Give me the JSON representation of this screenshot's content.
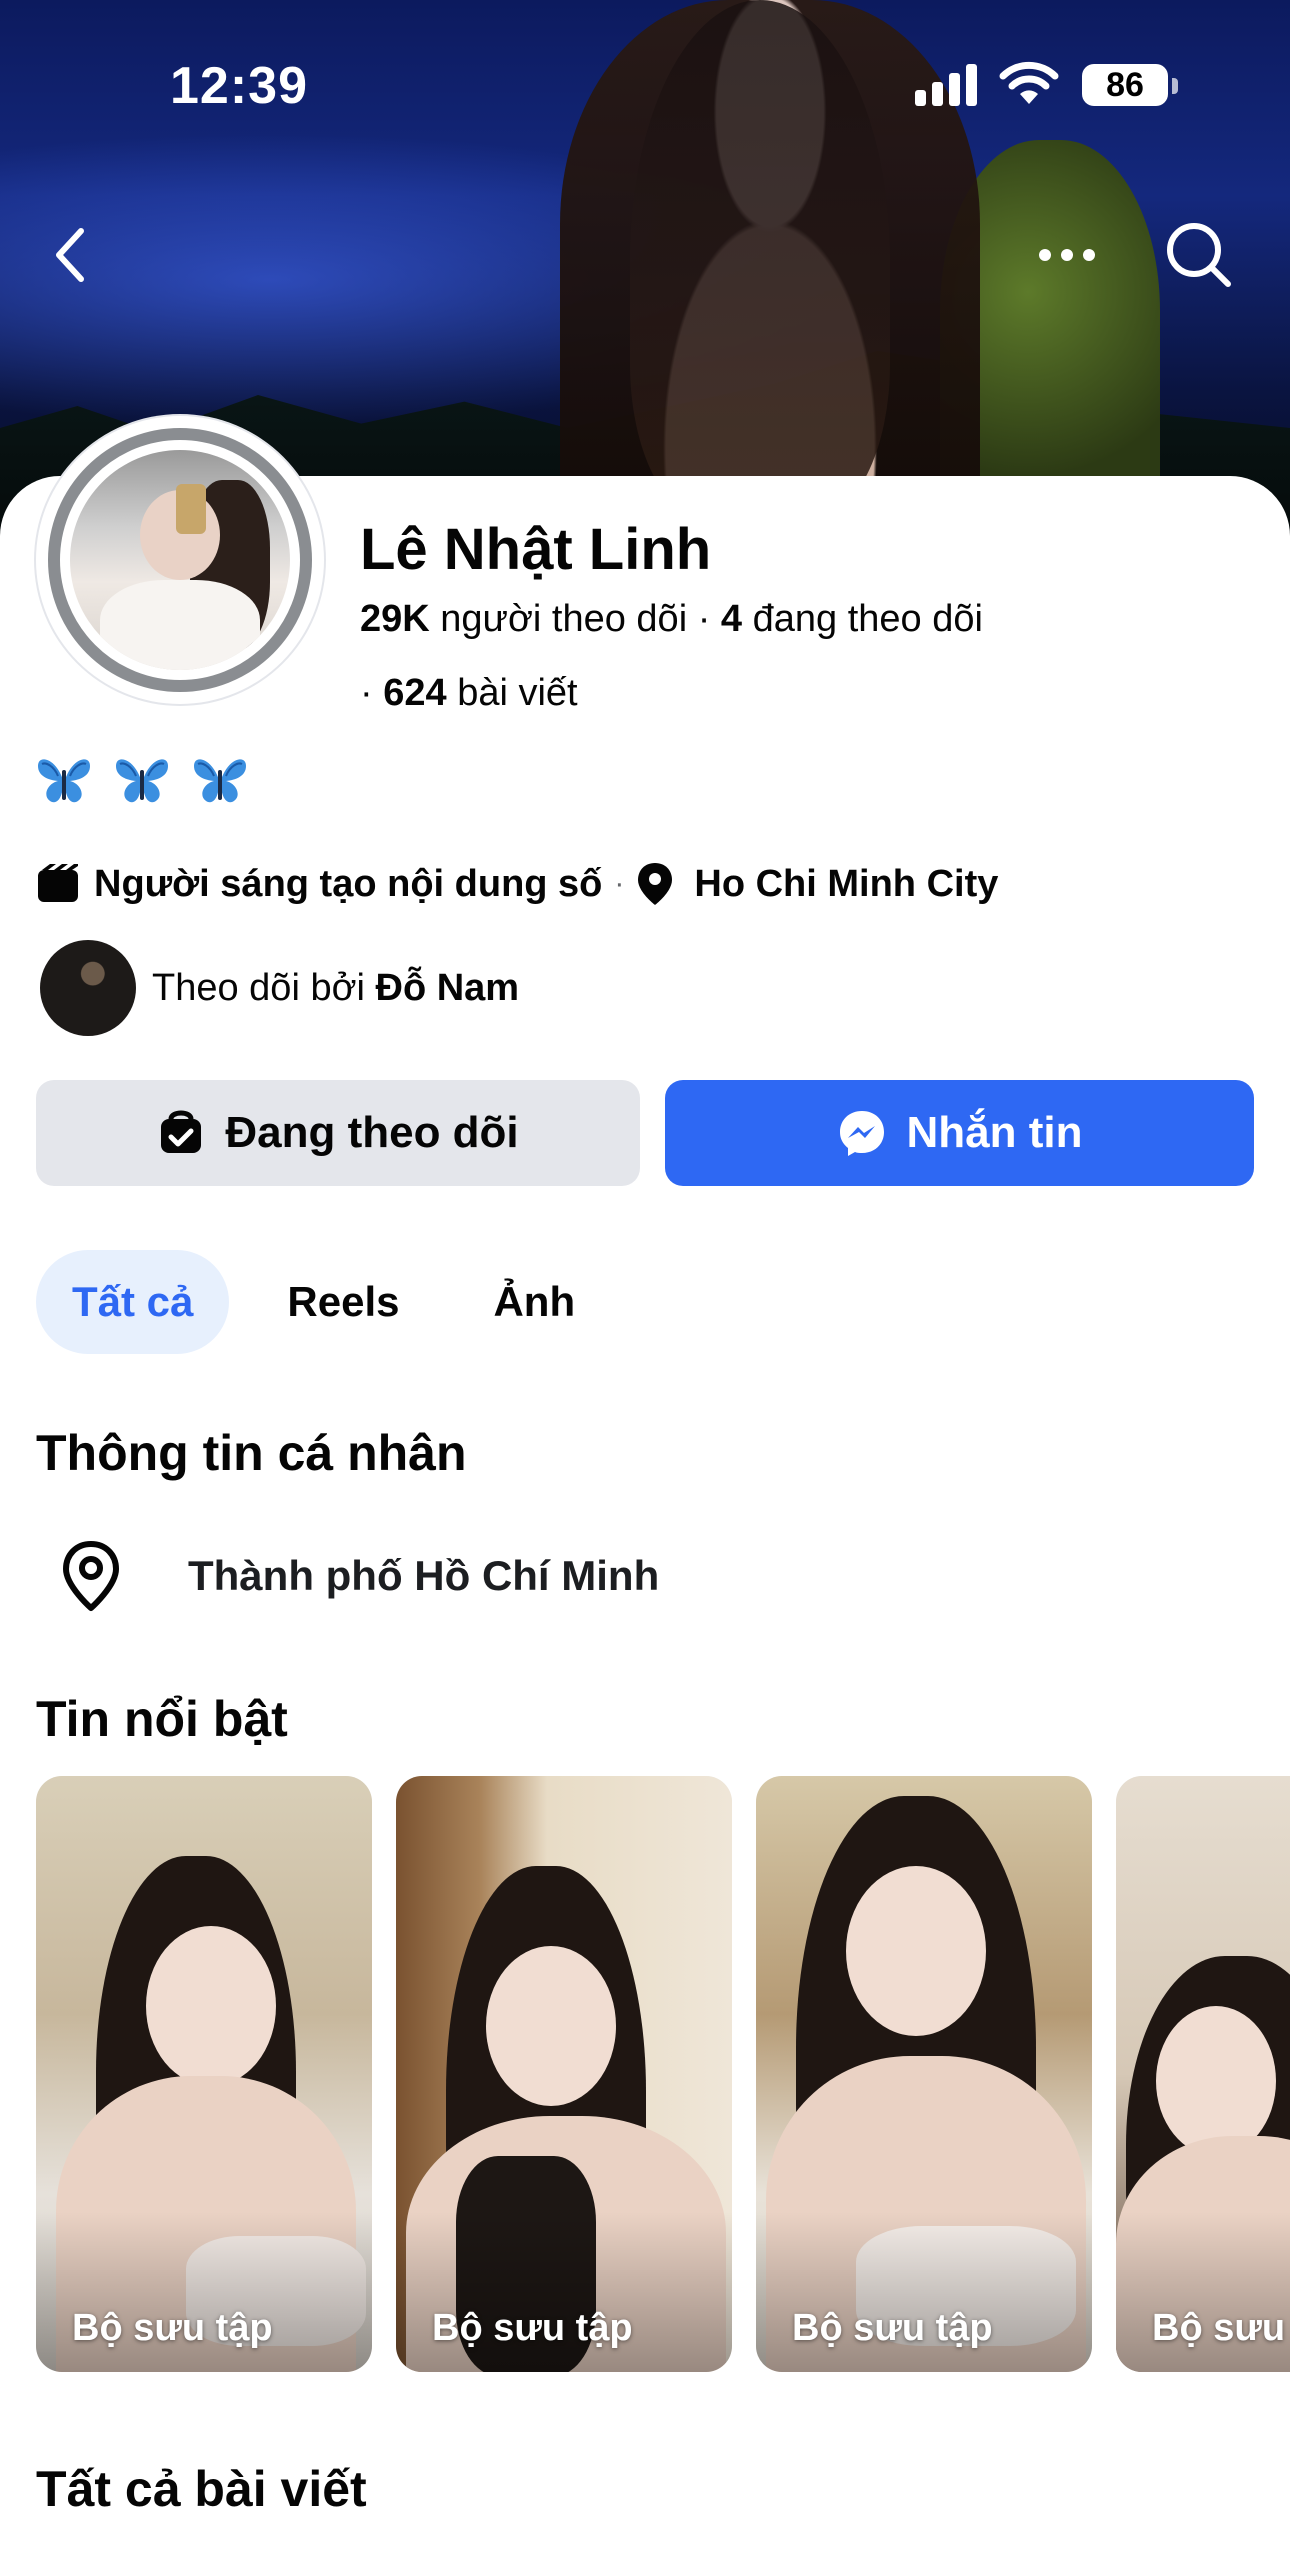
{
  "status_bar": {
    "time": "12:39",
    "battery": "86"
  },
  "profile": {
    "name": "Lê Nhật Linh",
    "followers_count": "29K",
    "followers_label": "người theo dõi",
    "following_count": "4",
    "following_label": "đang theo dõi",
    "posts_count": "624",
    "posts_label": "bài viết",
    "bio_emojis": [
      "butterfly-icon",
      "butterfly-icon",
      "butterfly-icon"
    ],
    "category": "Người sáng tạo nội dung số",
    "city": "Ho Chi Minh City",
    "followed_by_prefix": "Theo dõi bởi",
    "followed_by_name": "Đỗ Nam"
  },
  "actions": {
    "following_label": "Đang theo dõi",
    "message_label": "Nhắn tin"
  },
  "tabs": [
    {
      "label": "Tất cả",
      "active": true
    },
    {
      "label": "Reels",
      "active": false
    },
    {
      "label": "Ảnh",
      "active": false
    }
  ],
  "personal_info": {
    "title": "Thông tin cá nhân",
    "location": "Thành phố Hồ Chí Minh"
  },
  "highlights": {
    "title": "Tin nổi bật",
    "items": [
      {
        "label": "Bộ sưu tập"
      },
      {
        "label": "Bộ sưu tập"
      },
      {
        "label": "Bộ sưu tập"
      },
      {
        "label": "Bộ sưu"
      }
    ]
  },
  "posts": {
    "title": "Tất cả bài viết"
  },
  "colors": {
    "accent": "#2e68f3",
    "tab_active_bg": "#e7f0fd",
    "secondary_button": "#e4e6eb"
  }
}
